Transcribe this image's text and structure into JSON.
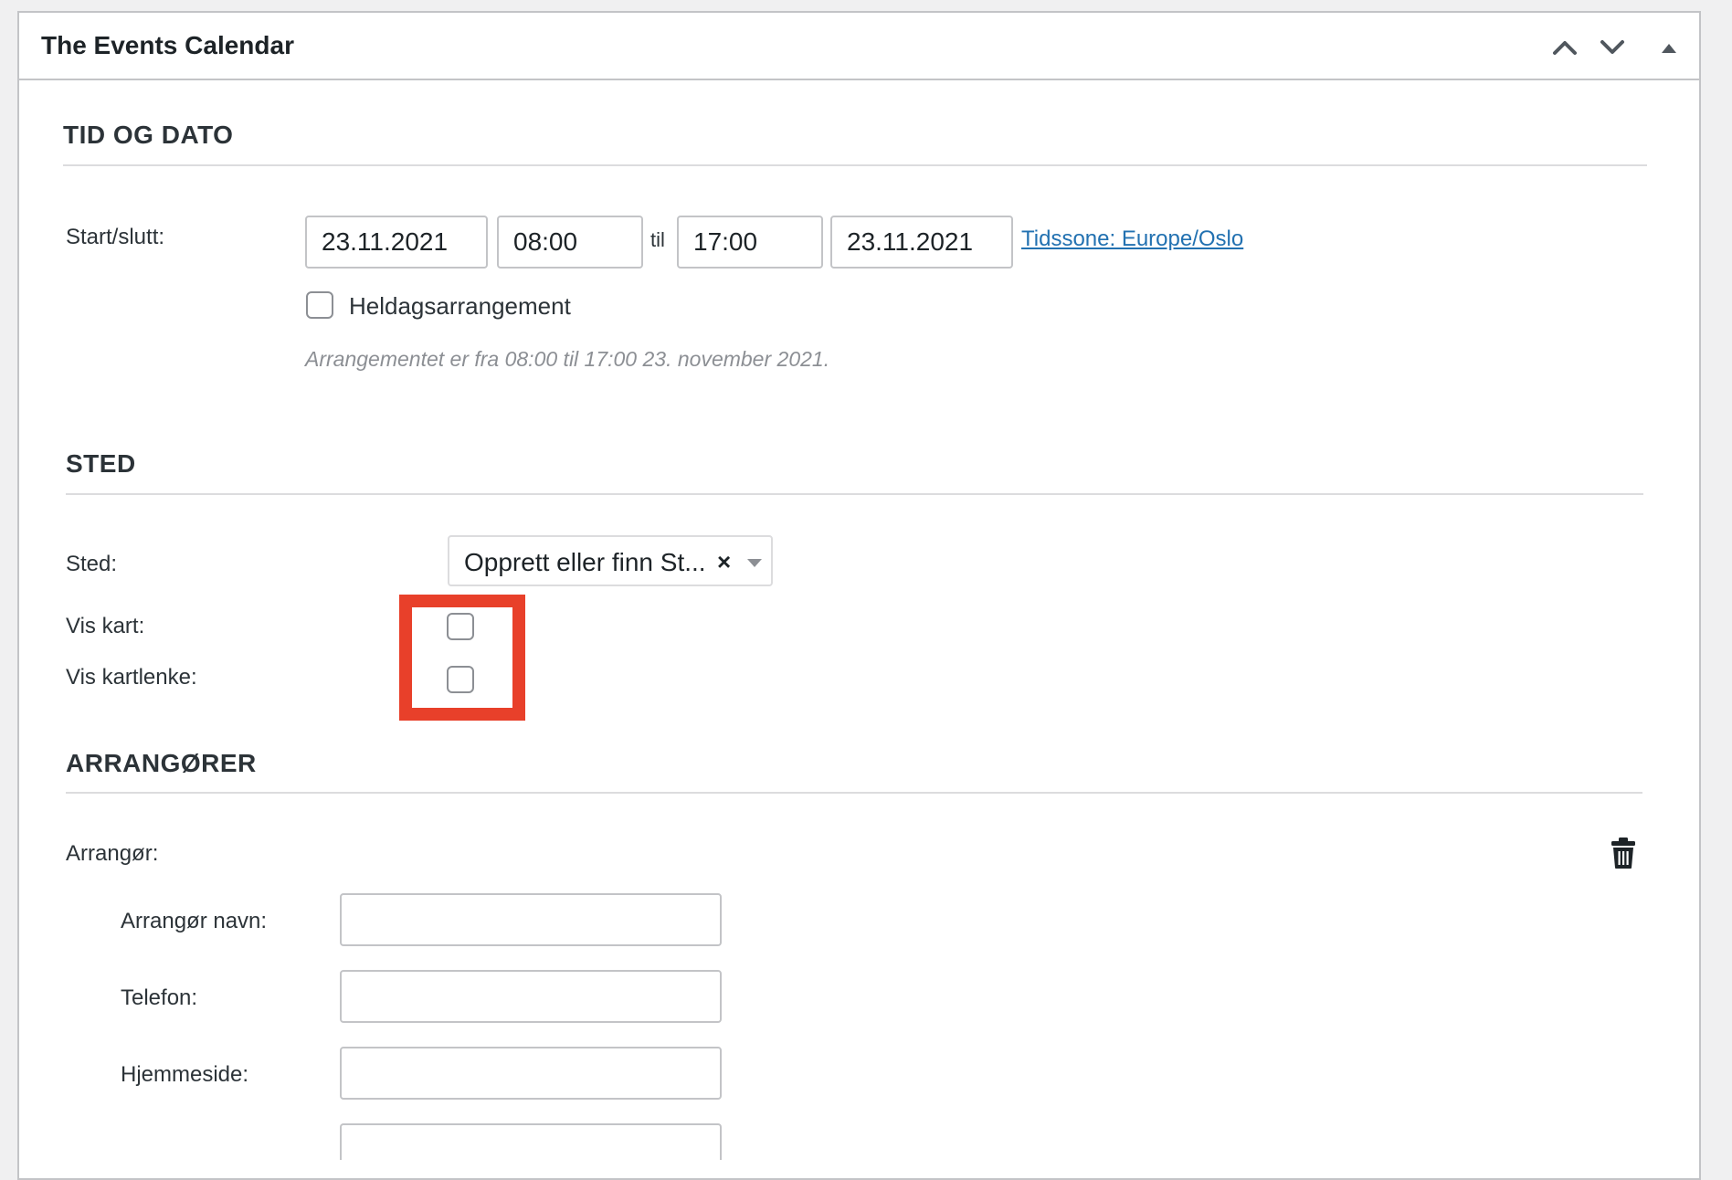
{
  "panel": {
    "title": "The Events Calendar",
    "controls": [
      "move-up-icon",
      "move-down-icon",
      "toggle-panel-icon"
    ]
  },
  "time_date": {
    "heading": "TID OG DATO",
    "start_end_label": "Start/slutt:",
    "start_date": "23.11.2021",
    "start_time": "08:00",
    "to_label": "til",
    "end_time": "17:00",
    "end_date": "23.11.2021",
    "timezone_link": "Tidssone: Europe/Oslo",
    "all_day_label": "Heldagsarrangement",
    "all_day_checked": false,
    "summary": "Arrangementet er fra 08:00 til 17:00 23. november 2021."
  },
  "venue": {
    "heading": "STED",
    "venue_label": "Sted:",
    "venue_select_value": "Opprett eller finn St...",
    "venue_clear": "×",
    "show_map_label": "Vis kart:",
    "show_map_checked": false,
    "show_map_link_label": "Vis kartlenke:",
    "show_map_link_checked": false,
    "highlight_color": "#e8402a"
  },
  "organizers": {
    "heading": "ARRANGØRER",
    "organizer_label": "Arrangør:",
    "name_label": "Arrangør navn:",
    "name_value": "",
    "phone_label": "Telefon:",
    "phone_value": "",
    "website_label": "Hjemmeside:",
    "website_value": "",
    "email_value": "",
    "delete_icon": "trash-icon"
  }
}
